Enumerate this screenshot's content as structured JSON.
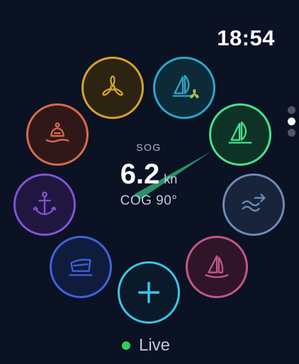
{
  "status_bar": {
    "time": "18:54"
  },
  "readout": {
    "sog_label": "SOG",
    "sog_value": "6.2",
    "sog_unit": "kn",
    "cog_text": "COG 90°"
  },
  "buttons": [
    {
      "id": "engine",
      "icon": "propeller-icon",
      "color": "#d7a12a",
      "fill": "#2c2410"
    },
    {
      "id": "sailing-trim",
      "icon": "sailboat-propeller-icon",
      "color": "#2aa7c9",
      "fill": "#0c2a38"
    },
    {
      "id": "sailing-active",
      "icon": "sailboat-icon",
      "color": "#49e08f",
      "fill": "#0e3326",
      "selected": true
    },
    {
      "id": "drifting",
      "icon": "waves-arrow-icon",
      "color": "#6e8ab4",
      "fill": "#17243b"
    },
    {
      "id": "racing",
      "icon": "sailboat-outline-icon",
      "color": "#c2568a",
      "fill": "#2f1527"
    },
    {
      "id": "add",
      "icon": "plus-icon",
      "color": "#37c7e8",
      "fill": "#0a1a2a"
    },
    {
      "id": "docked",
      "icon": "dock-icon",
      "color": "#3f63d8",
      "fill": "#101c3d"
    },
    {
      "id": "anchored",
      "icon": "anchor-icon",
      "color": "#8551d6",
      "fill": "#211640"
    },
    {
      "id": "moored",
      "icon": "mooring-buoy-icon",
      "color": "#d76a4c",
      "fill": "#311818"
    }
  ],
  "page_indicator": {
    "pages": 3,
    "current": 2
  },
  "footer": {
    "live_label": "Live",
    "live_color": "#30d158"
  }
}
